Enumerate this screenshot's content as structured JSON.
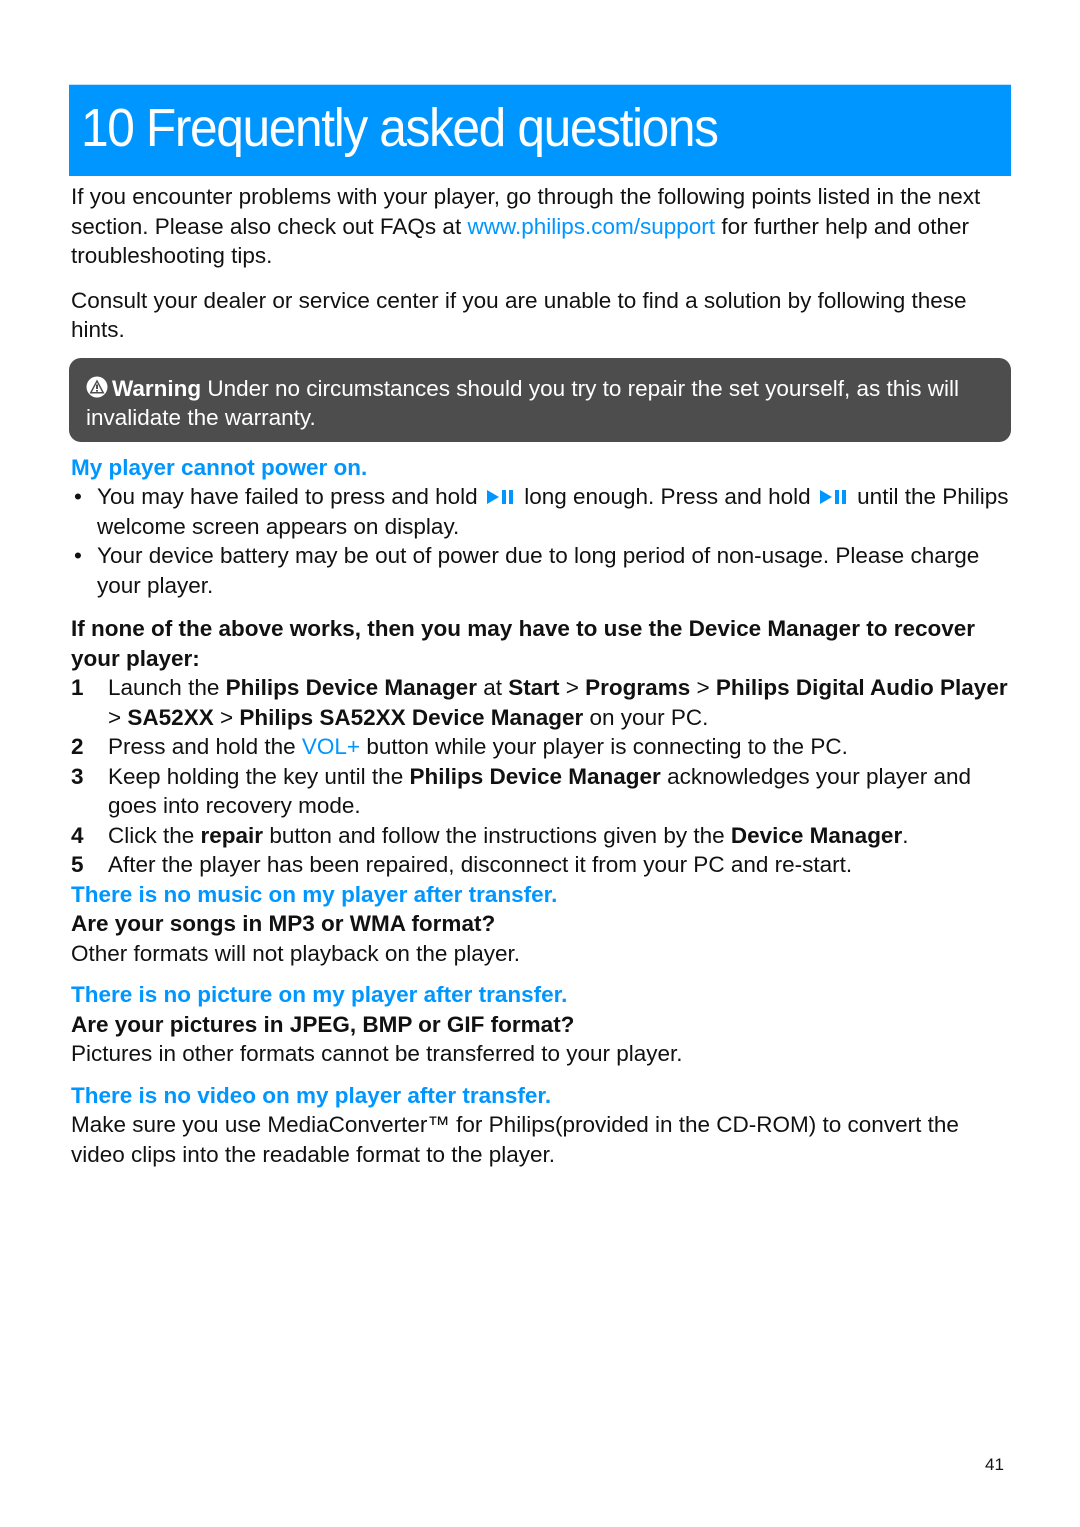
{
  "header": {
    "title": "10 Frequently asked questions"
  },
  "intro": {
    "p1_before_link": "If you encounter problems with your player, go through the following points listed in the next section. Please also check out FAQs at ",
    "p1_link": "www.philips.com/support",
    "p1_after_link": " for further help and other troubleshooting tips.",
    "p2": "Consult your dealer or service center if you are unable to find a solution by following these hints."
  },
  "warning": {
    "icon": "warning-icon",
    "label": "Warning",
    "text": " Under no circumstances should you try to repair the set yourself, as this will invalidate the warranty."
  },
  "section_power": {
    "heading": "My player cannot power on.",
    "bullet_char": "•",
    "bullet1": {
      "part1": "You may have failed to press and hold ",
      "icon": "play-pause-icon",
      "part2": " long enough. Press and hold ",
      "part3": " until the Philips welcome screen appears on display."
    },
    "bullet2": "Your device battery may be out of power due to long period of non-usage. Please charge your player."
  },
  "recover": {
    "heading": "If none of the above works, then you may have to use the Device Manager to recover your player:",
    "steps": [
      {
        "num": "1",
        "a": "Launch the ",
        "b": "Philips Device Manager",
        "c": " at ",
        "d": "Start",
        "e": " > ",
        "f": "Programs",
        "g": " > ",
        "h": "Philips Digital Audio Player",
        "i": " > ",
        "j": "SA52XX",
        "k": " > ",
        "l": "Philips SA52XX Device Manager",
        "m": " on your PC."
      },
      {
        "num": "2",
        "a": "Press and hold the ",
        "b": "VOL+",
        "c": " button while your player is connecting to the PC."
      },
      {
        "num": "3",
        "a": "Keep holding the key until the ",
        "b": "Philips Device Manager",
        "c": " acknowledges your player and goes into recovery mode."
      },
      {
        "num": "4",
        "a": "Click the ",
        "b": "repair",
        "c": " button and follow the instructions given by the ",
        "d": "Device Manager",
        "e": "."
      },
      {
        "num": "5",
        "a": "After the player has been repaired, disconnect it from your PC and re-start."
      }
    ]
  },
  "section_music": {
    "heading": "There is no music on my player after transfer.",
    "question": "Are your songs in MP3 or WMA format?",
    "answer": "Other formats will not playback on the player."
  },
  "section_picture": {
    "heading": "There is no picture on my player after transfer.",
    "question": "Are your pictures in JPEG, BMP or GIF format?",
    "answer": "Pictures in other formats cannot be transferred to your player."
  },
  "section_video": {
    "heading": "There is no video on my player after transfer.",
    "answer": "Make sure you use MediaConverter™ for Philips(provided in the CD-ROM) to convert the video clips into the readable format to the player."
  },
  "footer": {
    "page_number": "41"
  },
  "colors": {
    "accent_blue": "#0096ff",
    "warning_bg": "#4d4d4d",
    "text": "#111111"
  }
}
